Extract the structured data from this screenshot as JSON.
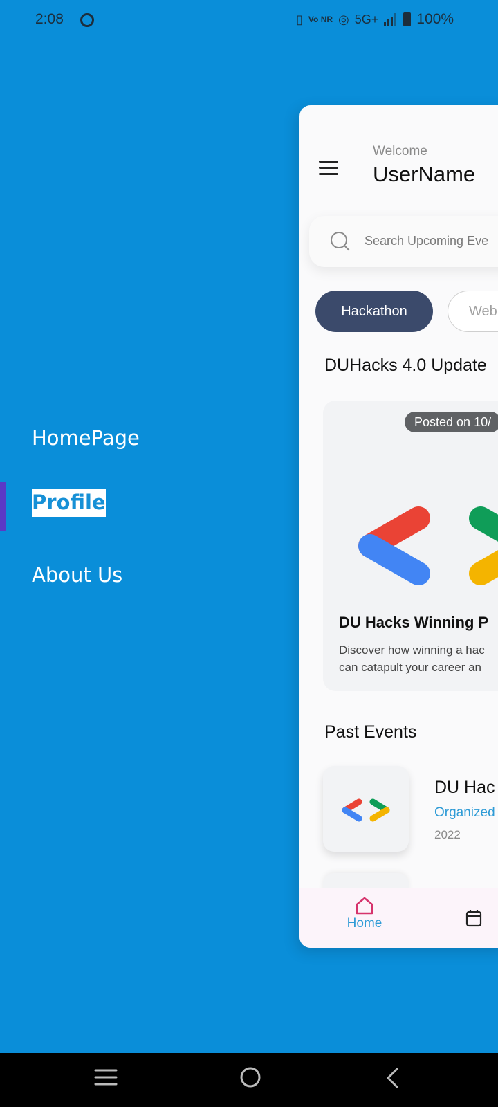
{
  "status_bar": {
    "time": "2:08",
    "network_small": "Vo NR",
    "network": "5G+",
    "battery": "100%"
  },
  "drawer": {
    "items": [
      {
        "label": "HomePage"
      },
      {
        "label": "Profile",
        "selected": true
      },
      {
        "label": "About Us"
      }
    ]
  },
  "header": {
    "welcome": "Welcome",
    "username": "UserName"
  },
  "search": {
    "placeholder": "Search Upcoming Eve"
  },
  "chips": [
    {
      "label": "Hackathon",
      "active": true
    },
    {
      "label": "Web",
      "active": false
    }
  ],
  "updates": {
    "section_title": "DUHacks 4.0 Update",
    "card": {
      "posted": "Posted on 10/",
      "title": "DU Hacks Winning P",
      "desc_line1": "Discover how winning a hac",
      "desc_line2": "can catapult your career an"
    }
  },
  "past_events": {
    "section_title": "Past Events",
    "items": [
      {
        "title": "DU Hac",
        "organizer": "Organized",
        "year": "2022"
      }
    ]
  },
  "bottom_nav": {
    "home_label": "Home"
  },
  "colors": {
    "background": "#0A8ED9",
    "accent": "#2E9BD6",
    "chip_active": "#3B4A6B",
    "drawer_indicator": "#5B39C6"
  }
}
